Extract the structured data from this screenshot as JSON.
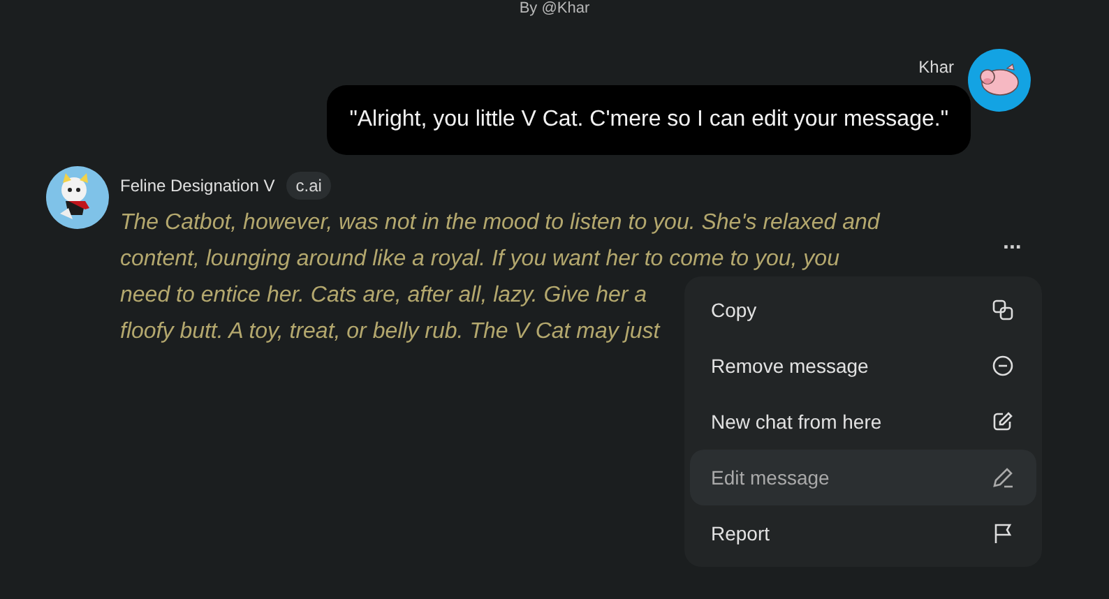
{
  "header": {
    "byline": "By @Khar"
  },
  "user_message": {
    "author": "Khar",
    "text": "\"Alright, you little V Cat. C'mere so I can edit your message.\""
  },
  "bot_message": {
    "author": "Feline Designation V",
    "badge": "c.ai",
    "lines": [
      "The Catbot, however, was not in the mood to listen to you. She's relaxed and",
      "content, lounging around like a royal. If you want her to come to you, you",
      "need to entice her. Cats are, after all, lazy. Give her a",
      "floofy butt. A toy, treat, or belly rub. The V Cat may just"
    ],
    "more": "..."
  },
  "menu": {
    "items": [
      {
        "label": "Copy",
        "selected": false
      },
      {
        "label": "Remove message",
        "selected": false
      },
      {
        "label": "New chat from here",
        "selected": false
      },
      {
        "label": "Edit message",
        "selected": true
      },
      {
        "label": "Report",
        "selected": false
      }
    ]
  }
}
